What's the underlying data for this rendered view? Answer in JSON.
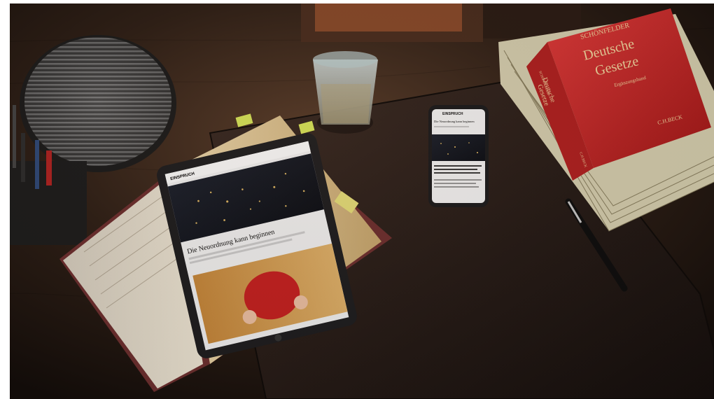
{
  "photo": {
    "tablet": {
      "brand": "EINSPRUCH",
      "headline": "Die Neuordnung kann beginnen"
    },
    "phone": {
      "brand": "EINSPRUCH",
      "headline": "Die Neuordnung kann beginnen"
    },
    "book": {
      "publisher": "SCHÖNFELDER",
      "title_line1": "Deutsche",
      "title_line2": "Gesetze",
      "subtitle": "Ergänzungsband",
      "imprint": "C.H.BECK",
      "spine_title_line1": "Deutsche",
      "spine_title_line2": "Gesetze",
      "spine_publisher": "SCHÖNFELDER",
      "spine_imprint": "C.H.BECK"
    }
  }
}
